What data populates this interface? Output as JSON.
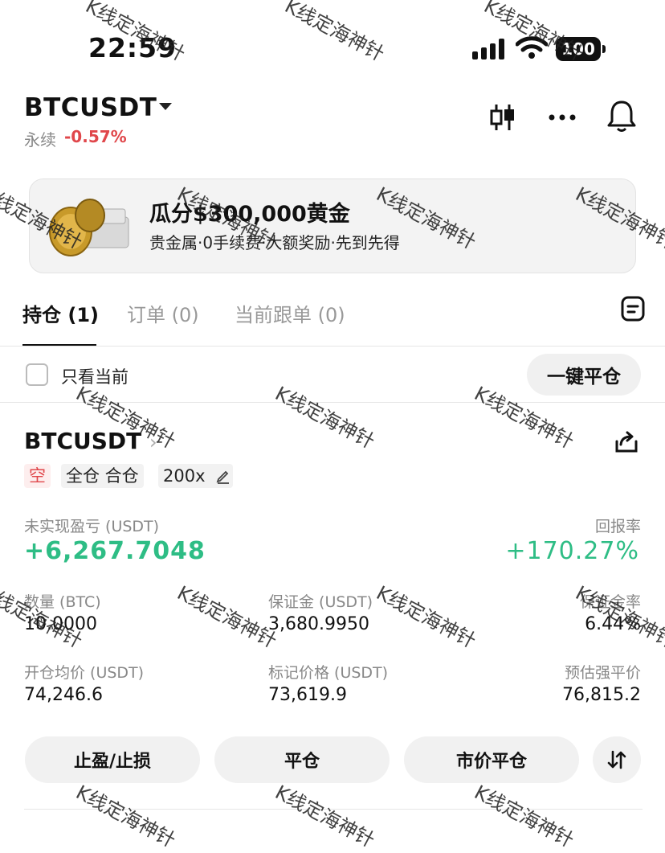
{
  "status_bar": {
    "time": "22:59",
    "battery": "100"
  },
  "header": {
    "symbol": "BTCUSDT",
    "contract_type": "永续",
    "change": "-0.57%"
  },
  "icons": [
    "candlestick-icon",
    "more-icon",
    "bell-icon",
    "notes-icon",
    "share-icon",
    "edit-icon",
    "swap-icon"
  ],
  "banner": {
    "title": "瓜分$300,000黄金",
    "subtitle": "贵金属·0手续费·大额奖励·先到先得"
  },
  "tabs": [
    {
      "label": "持仓 (1)",
      "active": true
    },
    {
      "label": "订单 (0)",
      "active": false
    },
    {
      "label": "当前跟单 (0)",
      "active": false
    }
  ],
  "filter": {
    "label": "只看当前",
    "close_all": "一键平仓"
  },
  "position": {
    "symbol": "BTCUSDT",
    "side_tag": "空",
    "margin_tag": "全仓 合仓",
    "leverage_tag": "200x",
    "pnl_label": "未实现盈亏 (USDT)",
    "pnl_value": "+6,267.7048",
    "roe_label": "回报率",
    "roe_value": "+170.27%",
    "qty_label": "数量 (BTC)",
    "qty_value": "10.0000",
    "margin_label": "保证金 (USDT)",
    "margin_value": "3,680.9950",
    "margin_ratio_label": "保证金率",
    "margin_ratio_value": "6.44%",
    "entry_label": "开仓均价 (USDT)",
    "entry_value": "74,246.6",
    "mark_label": "标记价格 (USDT)",
    "mark_value": "73,619.9",
    "liq_label": "预估强平价",
    "liq_value": "76,815.2"
  },
  "actions": {
    "tpsl": "止盈/止损",
    "close": "平仓",
    "market_close": "市价平仓"
  },
  "watermark": "K线定海神针",
  "colors": {
    "up": "#2ebd85",
    "down": "#e0474b"
  }
}
